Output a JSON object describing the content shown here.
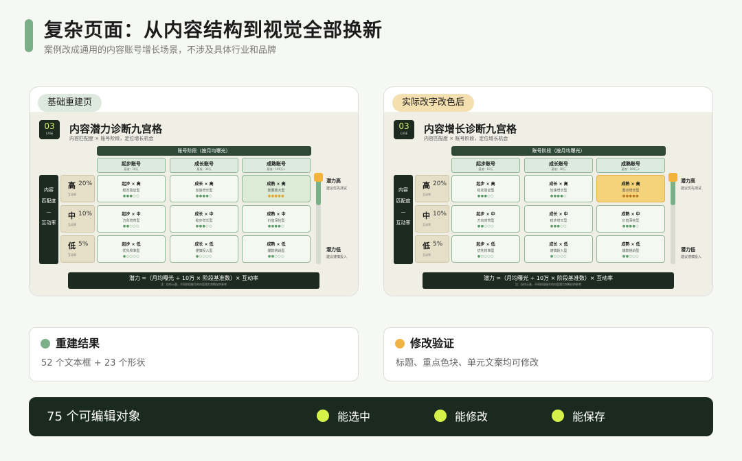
{
  "header": {
    "title": "复杂页面：从内容结构到视觉全部换新",
    "subtitle": "案例改成通用的内容账号增长场景，不涉及具体行业和品牌"
  },
  "cards": [
    {
      "tag": "基础重建页",
      "badge_num": "03",
      "badge_caption": "CASE",
      "title": "内容潜力诊断九宫格",
      "subtitle": "内容匹配度 × 账号阶段，定位增长机会"
    },
    {
      "tag": "实际改字改色后",
      "badge_num": "03",
      "badge_caption": "CASE",
      "title": "内容增长诊断九宫格",
      "subtitle": "内容匹配度 × 账号阶段，定位增长机会"
    }
  ],
  "matrix": {
    "axis_top": "账号阶段（按月均曝光）",
    "columns": [
      {
        "title": "起步账号",
        "meta": "基准：10万"
      },
      {
        "title": "成长账号",
        "meta": "基准：30万"
      },
      {
        "title": "成熟账号",
        "meta": "基准：100万+"
      }
    ],
    "left_axis": [
      "内容",
      "匹配度",
      "—",
      "互动率"
    ],
    "rows": [
      {
        "level": "高",
        "pct": "20%",
        "label": "互动率"
      },
      {
        "level": "中",
        "pct": "10%",
        "label": "互动率"
      },
      {
        "level": "低",
        "pct": "5%",
        "label": "互动率"
      }
    ],
    "cells_left": [
      [
        {
          "t": "起步 × 高",
          "s": "稳定验证型",
          "stars": "●●●○○"
        },
        {
          "t": "成长 × 高",
          "s": "加速增长型",
          "stars": "●●●●○"
        },
        {
          "t": "成熟 × 高",
          "s": "放量放大型",
          "stars": "●●●●●"
        }
      ],
      [
        {
          "t": "起步 × 中",
          "s": "方向培育型",
          "stars": "●●○○○"
        },
        {
          "t": "成长 × 中",
          "s": "稳步增长型",
          "stars": "●●●○○"
        },
        {
          "t": "成熟 × 中",
          "s": "价值深挖型",
          "stars": "●●●●○"
        }
      ],
      [
        {
          "t": "起步 × 低",
          "s": "优先校准型",
          "stars": "●○○○○"
        },
        {
          "t": "成长 × 低",
          "s": "谨慎投入型",
          "stars": "●○○○○"
        },
        {
          "t": "成熟 × 低",
          "s": "爆款挑战型",
          "stars": "●●○○○"
        }
      ]
    ],
    "cells_right": [
      [
        {
          "t": "起步 × 高",
          "s": "稳定验证型",
          "stars": "●●●○○"
        },
        {
          "t": "成长 × 高",
          "s": "加速增长型",
          "stars": "●●●●○"
        },
        {
          "t": "成熟 × 高",
          "s": "重点增长型",
          "stars": "●●●●●"
        }
      ],
      [
        {
          "t": "起步 × 中",
          "s": "方向培育型",
          "stars": "●●○○○"
        },
        {
          "t": "成长 × 中",
          "s": "稳步增长型",
          "stars": "●●●○○"
        },
        {
          "t": "成熟 × 中",
          "s": "价值深挖型",
          "stars": "●●●●○"
        }
      ],
      [
        {
          "t": "起步 × 低",
          "s": "优先校准型",
          "stars": "●○○○○"
        },
        {
          "t": "成长 × 低",
          "s": "谨慎投入型",
          "stars": "●○○○○"
        },
        {
          "t": "成熟 × 低",
          "s": "爆款挑战型",
          "stars": "●●○○○"
        }
      ]
    ],
    "potential_high": {
      "title": "潜力高",
      "sub": "建议优先测试"
    },
    "potential_low": {
      "title": "潜力低",
      "sub": "建议谨慎投入"
    },
    "formula": "潜力 =（月均曝光 ÷ 10万 × 阶段基准数）× 互动率",
    "formula_note": "注：仅作示意，不同阶段账号的内容潜力判断仅供参考",
    "potential_level": 0.34
  },
  "info": [
    {
      "title": "重建结果",
      "desc": "52 个文本框 + 23 个形状",
      "dot_color": "#7aaf88"
    },
    {
      "title": "修改验证",
      "desc": "标题、重点色块、单元文案均可修改",
      "dot_color": "#efb445"
    }
  ],
  "bottom": {
    "count": "75 个可编辑对象",
    "features": [
      "能选中",
      "能修改",
      "能保存"
    ]
  },
  "colors": {
    "accent_green": "#7aaf88",
    "dark": "#1a2a1e",
    "highlight_yellow": "#f4d27a",
    "lime": "#d6f24a"
  }
}
